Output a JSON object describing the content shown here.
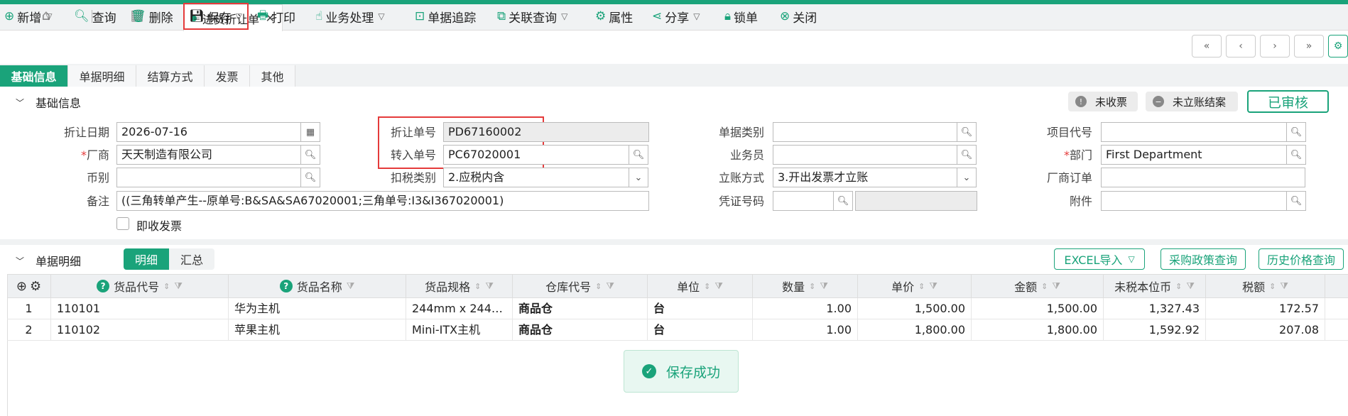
{
  "tabs": {
    "doc_tab": "进货折让单"
  },
  "toolbar": {
    "new": "新增",
    "query": "查询",
    "delete": "删除",
    "save": "保存",
    "print": "打印",
    "business": "业务处理",
    "trace": "单据追踪",
    "related": "关联查询",
    "props": "属性",
    "share": "分享",
    "lock": "锁单",
    "close": "关闭"
  },
  "subtabs": [
    "基础信息",
    "单据明细",
    "结算方式",
    "发票",
    "其他"
  ],
  "basic": {
    "title": "基础信息",
    "badge_invoice": "未收票",
    "badge_settle": "未立账结案",
    "status": "已审核",
    "labels": {
      "date": "折让日期",
      "vendor": "厂商",
      "currency": "币别",
      "remark": "备注",
      "doc_no": "折让单号",
      "transfer_no": "转入单号",
      "tax_type": "扣税类别",
      "doc_cat": "单据类别",
      "clerk": "业务员",
      "account_mode": "立账方式",
      "voucher": "凭证号码",
      "project": "项目代号",
      "dept": "部门",
      "vendor_order": "厂商订单",
      "attach": "附件",
      "instant_invoice": "即收发票"
    },
    "values": {
      "date": "2026-07-16",
      "vendor": "天天制造有限公司",
      "currency": "",
      "remark": "((三角转单产生--原单号:B&SA&SA67020001;三角单号:I3&I367020001)",
      "doc_no": "PD67160002",
      "transfer_no": "PC67020001",
      "tax_type": "2.应税内含",
      "doc_cat": "",
      "clerk": "",
      "account_mode": "3.开出发票才立账",
      "voucher": "",
      "project": "",
      "dept": "First Department",
      "vendor_order": "",
      "attach": ""
    }
  },
  "detail": {
    "title": "单据明细",
    "toggle_detail": "明细",
    "toggle_summary": "汇总",
    "btn_excel": "EXCEL导入",
    "btn_policy": "采购政策查询",
    "btn_history": "历史价格查询",
    "headers": [
      "货品代号",
      "货品名称",
      "货品规格",
      "仓库代号",
      "单位",
      "数量",
      "单价",
      "金额",
      "未税本位币",
      "税额"
    ],
    "rows": [
      {
        "no": "1",
        "code": "110101",
        "name": "华为主机",
        "spec": "244mm x 244mm…",
        "wh": "商品仓",
        "unit": "台",
        "qty": "1.00",
        "price": "1,500.00",
        "amount": "1,500.00",
        "net": "1,327.43",
        "tax": "172.57"
      },
      {
        "no": "2",
        "code": "110102",
        "name": "苹果主机",
        "spec": "Mini-ITX主机",
        "wh": "商品仓",
        "unit": "台",
        "qty": "1.00",
        "price": "1,800.00",
        "amount": "1,800.00",
        "net": "1,592.92",
        "tax": "207.08"
      }
    ]
  },
  "toast": {
    "message": "保存成功"
  },
  "colors": {
    "accent": "#1aa37a",
    "highlight": "#e53b3b"
  }
}
